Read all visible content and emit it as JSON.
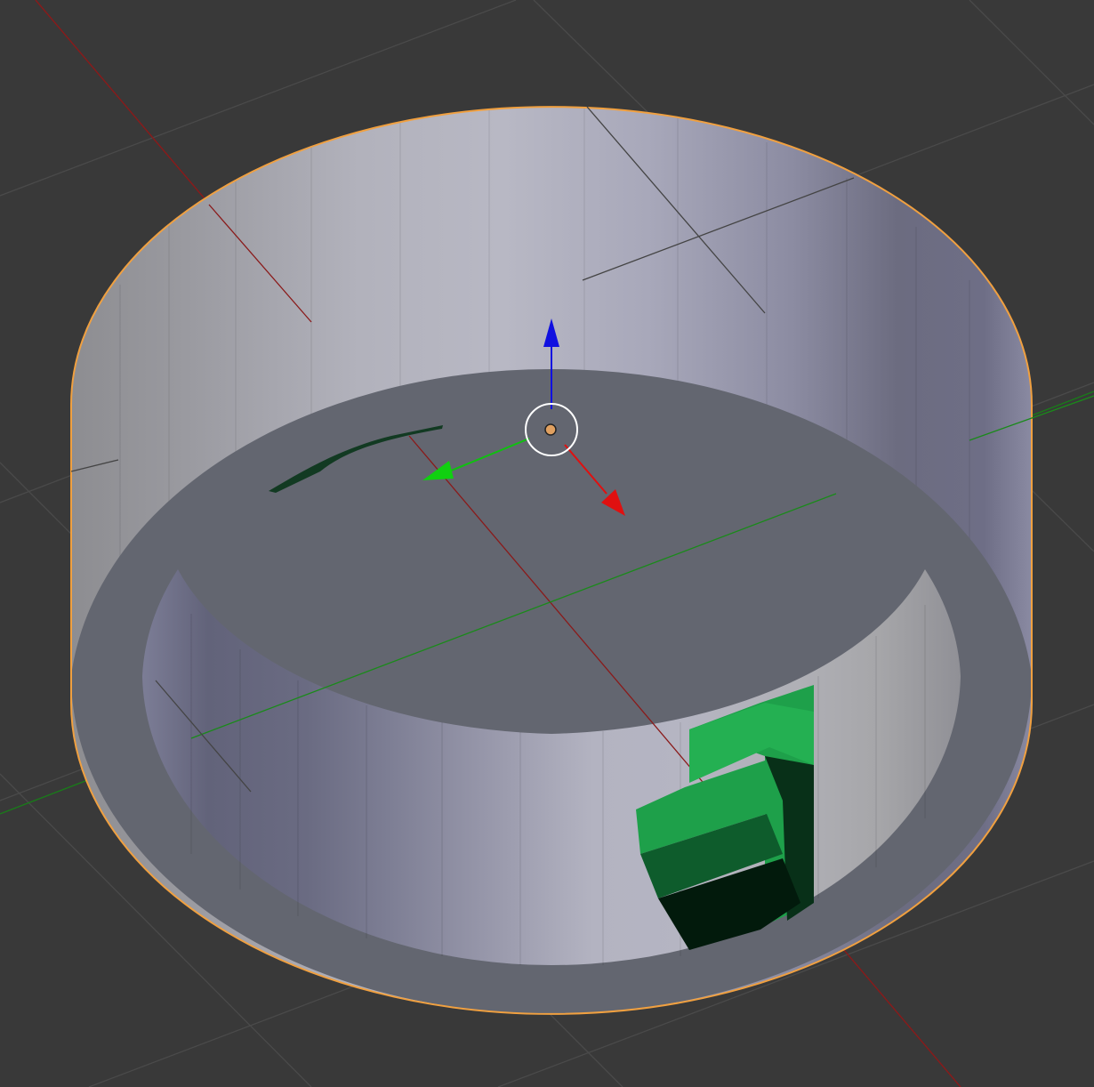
{
  "viewport": {
    "background": "#393939",
    "view": "3d-viewport",
    "selection_outline_color": "#f0a040"
  },
  "objects": [
    {
      "name": "hollow-cylinder",
      "selected": true,
      "color": "#a8a9bb"
    },
    {
      "name": "green-curved-block",
      "selected": false,
      "color": "#1ea04a"
    }
  ],
  "gizmo": {
    "type": "translate",
    "x_axis_color": "#e01010",
    "y_axis_color": "#10c010",
    "z_axis_color": "#1010e0",
    "pivot_color": "#e0a060"
  },
  "axes": {
    "x_color": "#8a1a1a",
    "y_color": "#1a7a1a",
    "grid_color": "#4a4a4a"
  }
}
